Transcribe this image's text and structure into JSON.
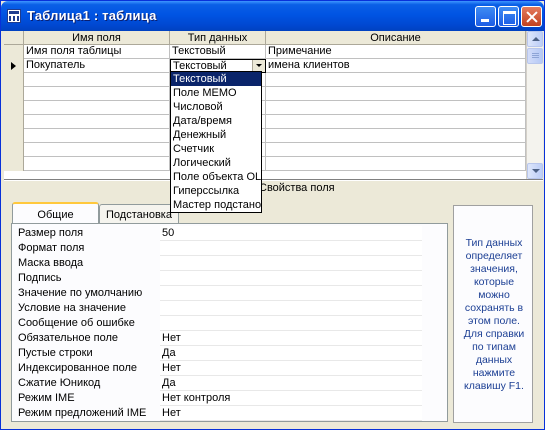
{
  "window": {
    "title": "Таблица1 : таблица"
  },
  "grid": {
    "headers": {
      "name": "Имя поля",
      "type": "Тип данных",
      "desc": "Описание"
    },
    "rows": [
      {
        "name": "Имя поля таблицы",
        "type": "Текстовый",
        "desc": "Примечание"
      },
      {
        "name": "Покупатель",
        "type": "Текстовый",
        "desc": "имена клиентов"
      }
    ]
  },
  "dropdown": {
    "options": [
      "Текстовый",
      "Поле MEMO",
      "Числовой",
      "Дата/время",
      "Денежный",
      "Счетчик",
      "Логический",
      "Поле объекта OLE",
      "Гиперссылка",
      "Мастер подстановок..."
    ],
    "selected": "Текстовый"
  },
  "section": {
    "label": "Свойства поля"
  },
  "tabs": {
    "general": "Общие",
    "substitution": "Подстановка"
  },
  "properties": [
    {
      "label": "Размер поля",
      "value": "50"
    },
    {
      "label": "Формат поля",
      "value": ""
    },
    {
      "label": "Маска ввода",
      "value": ""
    },
    {
      "label": "Подпись",
      "value": ""
    },
    {
      "label": "Значение по умолчанию",
      "value": ""
    },
    {
      "label": "Условие на значение",
      "value": ""
    },
    {
      "label": "Сообщение об ошибке",
      "value": ""
    },
    {
      "label": "Обязательное поле",
      "value": "Нет"
    },
    {
      "label": "Пустые строки",
      "value": "Да"
    },
    {
      "label": "Индексированное поле",
      "value": "Нет"
    },
    {
      "label": "Сжатие Юникод",
      "value": "Да"
    },
    {
      "label": "Режим IME",
      "value": "Нет контроля"
    },
    {
      "label": "Режим предложений IME",
      "value": "Нет"
    }
  ],
  "help": {
    "text": "Тип данных определяет значения, которые можно сохранять в этом поле. Для справки по типам данных нажмите клавишу F1."
  },
  "colors": {
    "titlebar": "#0054e3",
    "selection": "#0a246a",
    "help_text": "#1c3f94"
  },
  "icons": {
    "window": "table-icon",
    "min": "minimize-icon",
    "max": "maximize-icon",
    "close": "close-icon",
    "row_pointer": "current-row-icon",
    "combo": "dropdown-arrow-icon"
  }
}
